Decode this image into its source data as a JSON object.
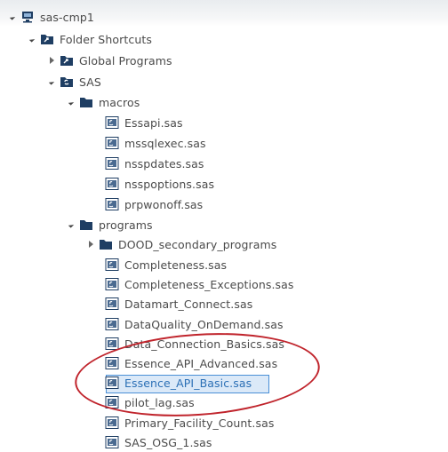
{
  "tree": {
    "root": {
      "label": "sas-cmp1",
      "icon": "server-icon"
    },
    "folder_shortcuts": {
      "label": "Folder Shortcuts",
      "icon": "folder-shortcut-icon"
    },
    "global_programs": {
      "label": "Global Programs",
      "icon": "folder-shortcut-icon"
    },
    "sas": {
      "label": "SAS",
      "icon": "sas-folder-icon"
    },
    "macros": {
      "label": "macros",
      "icon": "folder-icon",
      "files": [
        "Essapi.sas",
        "mssqlexec.sas",
        "nsspdates.sas",
        "nsspoptions.sas",
        "prpwonoff.sas"
      ]
    },
    "programs": {
      "label": "programs",
      "icon": "folder-icon",
      "subfolder": "DOOD_secondary_programs",
      "files": [
        "Completeness.sas",
        "Completeness_Exceptions.sas",
        "Datamart_Connect.sas",
        "DataQuality_OnDemand.sas",
        "Data_Connection_Basics.sas",
        "Essence_API_Advanced.sas",
        "Essence_API_Basic.sas",
        "pilot_lag.sas",
        "Primary_Facility_Count.sas",
        "SAS_OSG_1.sas"
      ]
    },
    "selected_item": "Essence_API_Basic.sas"
  },
  "colors": {
    "annotation_ellipse": "#c0242c",
    "selection_bg": "#dbe9f8",
    "folder_navy": "#1f3e63"
  }
}
